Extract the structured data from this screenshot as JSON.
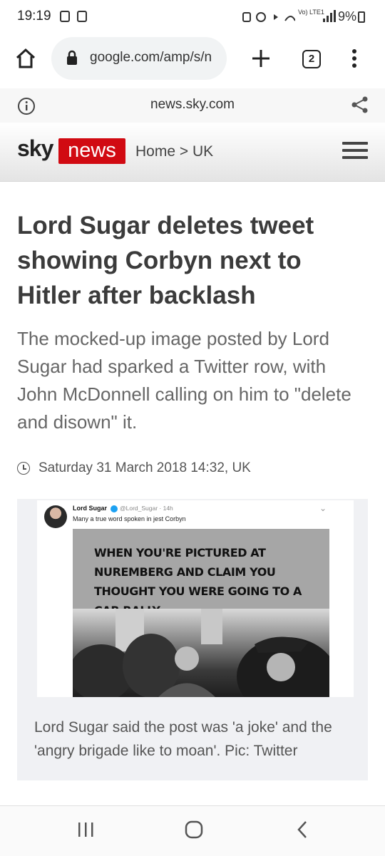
{
  "status_bar": {
    "time": "19:19",
    "network": "Vo) LTE1",
    "battery": "9%"
  },
  "browser": {
    "url": "google.com/amp/s/n",
    "tab_count": "2"
  },
  "amp_header": {
    "domain": "news.sky.com"
  },
  "site_header": {
    "logo_sky": "sky",
    "logo_news": "news",
    "breadcrumb": "Home > UK"
  },
  "article": {
    "headline": "Lord Sugar deletes tweet showing Corbyn next to Hitler after backlash",
    "standfirst": "The mocked-up image posted by Lord Sugar had sparked a Twitter row, with John McDonnell calling on him to \"delete and disown\" it.",
    "date": "Saturday 31 March 2018 14:32, UK",
    "image": {
      "tweet_name": "Lord Sugar",
      "tweet_handle": "@Lord_Sugar · 14h",
      "tweet_text": "Many a true word spoken in jest Corbyn",
      "meme_text": "WHEN YOU'RE PICTURED AT NUREMBERG AND CLAIM YOU THOUGHT YOU WERE GOING TO A CAR RALLY"
    },
    "caption": "Lord Sugar said the post was 'a joke' and the 'angry brigade like to moan'. Pic: Twitter"
  }
}
